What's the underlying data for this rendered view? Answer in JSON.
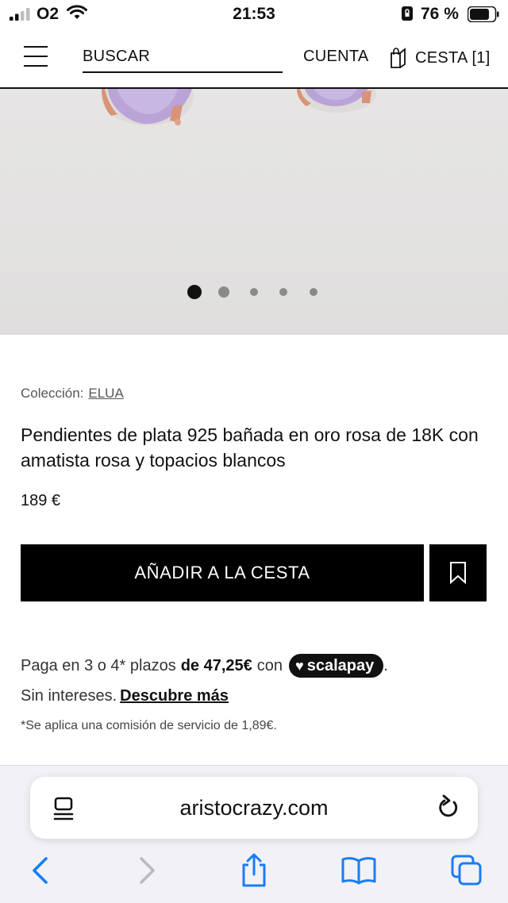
{
  "status_bar": {
    "carrier": "O2",
    "time": "21:53",
    "battery": "76 %"
  },
  "header": {
    "search_label": "BUSCAR",
    "account_label": "CUENTA",
    "cart_label": "CESTA [1]"
  },
  "gallery": {
    "image_count": 5,
    "active_index": 0
  },
  "product": {
    "collection_label": "Colección:",
    "collection_name": "ELUA",
    "title": "Pendientes de plata 925 bañada en oro rosa de 18K con amatista rosa y topacios blancos",
    "price": "189 €",
    "add_to_cart_label": "AÑADIR A LA CESTA"
  },
  "payment": {
    "line1_prefix": "Paga en 3 o 4* plazos",
    "line1_amount": "de 47,25€",
    "line1_suffix": "con",
    "provider": "scalapay",
    "period": ".",
    "line2_text": "Sin intereses.",
    "line2_link": "Descubre más",
    "fee_note": "*Se aplica una comisión de servicio de 1,89€."
  },
  "browser": {
    "url": "aristocrazy.com"
  },
  "colors": {
    "stone": "#b59fd6",
    "gold": "#d8957a",
    "button": "#000000"
  }
}
